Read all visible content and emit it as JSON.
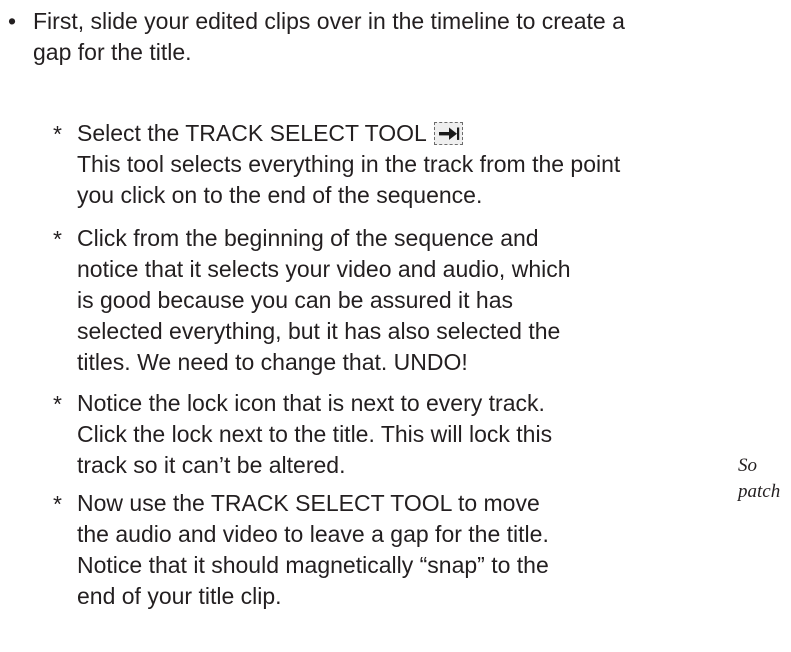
{
  "bullet": {
    "marker": "•",
    "lines": [
      "First, slide your edited clips over in the timeline to create a",
      "gap for the title."
    ]
  },
  "steps": [
    {
      "marker": "*",
      "lines": [
        "Select the TRACK SELECT TOOL",
        "This tool selects everything in the track from the point",
        "you click on to the end of the sequence."
      ],
      "icon": "track-select-arrow-icon"
    },
    {
      "marker": "*",
      "lines": [
        "Click from the beginning of the sequence and",
        "notice that it selects your video and audio, which",
        "is good because you can be assured it has",
        "selected everything, but it has also selected the",
        "titles. We need to change that. UNDO!"
      ]
    },
    {
      "marker": "*",
      "lines": [
        "Notice the lock icon that is next to every track.",
        "Click the lock next to the title. This will lock this",
        "track so it can’t be altered."
      ]
    },
    {
      "marker": "*",
      "lines": [
        "Now use the TRACK SELECT TOOL to move",
        "the audio and video to leave a gap for the title.",
        "Notice that it should magnetically “snap” to the",
        "end of your title clip."
      ]
    }
  ],
  "side_caption": {
    "lines": [
      "So",
      "patch"
    ]
  }
}
